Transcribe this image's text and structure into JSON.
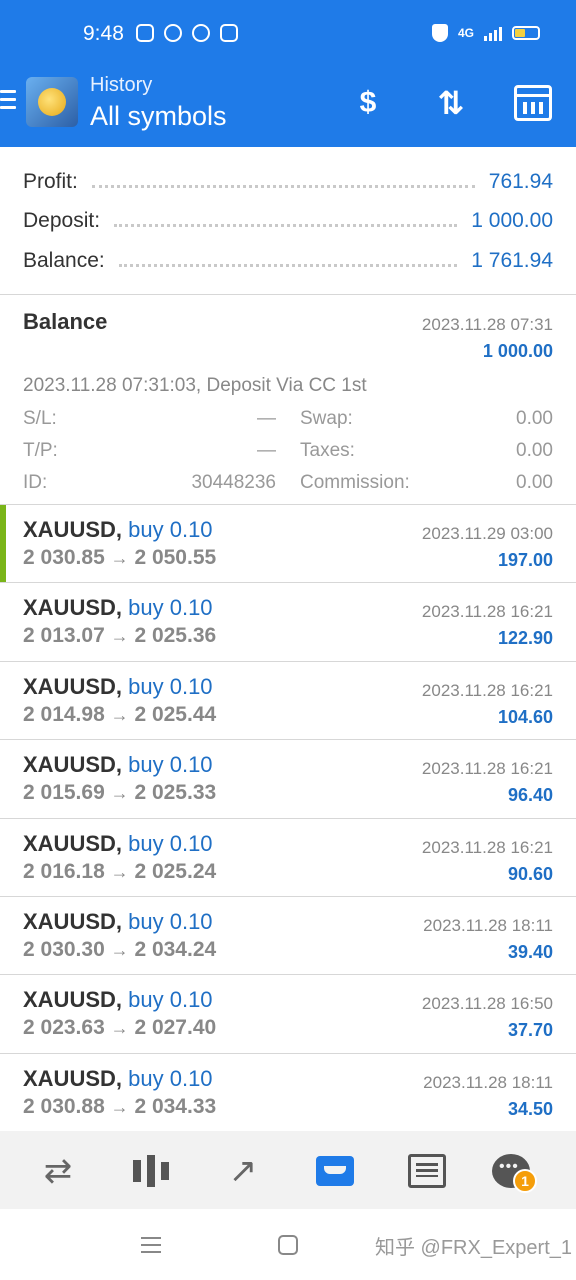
{
  "status_bar": {
    "time": "9:48",
    "network": "4G"
  },
  "header": {
    "subtitle": "History",
    "title": "All symbols",
    "deposit_icon": "$"
  },
  "summary": [
    {
      "label": "Profit:",
      "value": "761.94"
    },
    {
      "label": "Deposit:",
      "value": "1 000.00"
    },
    {
      "label": "Balance:",
      "value": "1 761.94"
    }
  ],
  "balance_entry": {
    "title": "Balance",
    "date": "2023.11.28 07:31",
    "amount": "1 000.00",
    "comment": "2023.11.28 07:31:03, Deposit Via CC 1st",
    "sl_label": "S/L:",
    "sl_value": "—",
    "tp_label": "T/P:",
    "tp_value": "—",
    "id_label": "ID:",
    "id_value": "30448236",
    "swap_label": "Swap:",
    "swap_value": "0.00",
    "taxes_label": "Taxes:",
    "taxes_value": "0.00",
    "commission_label": "Commission:",
    "commission_value": "0.00"
  },
  "trades": [
    {
      "symbol": "XAUUSD,",
      "side": "buy 0.10",
      "open": "2 030.85",
      "close": "2 050.55",
      "date": "2023.11.29 03:00",
      "profit": "197.00"
    },
    {
      "symbol": "XAUUSD,",
      "side": "buy 0.10",
      "open": "2 013.07",
      "close": "2 025.36",
      "date": "2023.11.28 16:21",
      "profit": "122.90"
    },
    {
      "symbol": "XAUUSD,",
      "side": "buy 0.10",
      "open": "2 014.98",
      "close": "2 025.44",
      "date": "2023.11.28 16:21",
      "profit": "104.60"
    },
    {
      "symbol": "XAUUSD,",
      "side": "buy 0.10",
      "open": "2 015.69",
      "close": "2 025.33",
      "date": "2023.11.28 16:21",
      "profit": "96.40"
    },
    {
      "symbol": "XAUUSD,",
      "side": "buy 0.10",
      "open": "2 016.18",
      "close": "2 025.24",
      "date": "2023.11.28 16:21",
      "profit": "90.60"
    },
    {
      "symbol": "XAUUSD,",
      "side": "buy 0.10",
      "open": "2 030.30",
      "close": "2 034.24",
      "date": "2023.11.28 18:11",
      "profit": "39.40"
    },
    {
      "symbol": "XAUUSD,",
      "side": "buy 0.10",
      "open": "2 023.63",
      "close": "2 027.40",
      "date": "2023.11.28 16:50",
      "profit": "37.70"
    },
    {
      "symbol": "XAUUSD,",
      "side": "buy 0.10",
      "open": "2 030.88",
      "close": "2 034.33",
      "date": "2023.11.28 18:11",
      "profit": "34.50"
    }
  ],
  "trade_arrow": "→",
  "bottom_nav": {
    "chat_badge": "1"
  },
  "watermark": "知乎 @FRX_Expert_1",
  "colors": {
    "header_bg": "#1f7be8",
    "value_blue": "#1f6fc5",
    "selected_marker": "#7ab519",
    "badge": "#f59e0b"
  }
}
